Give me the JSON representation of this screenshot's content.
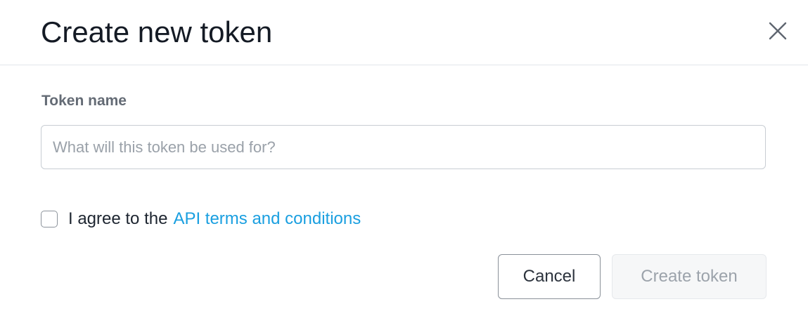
{
  "dialog": {
    "title": "Create new token",
    "close_icon": "close-icon"
  },
  "form": {
    "token_name_label": "Token name",
    "token_name_value": "",
    "token_name_placeholder": "What will this token be used for?",
    "agree_checked": false,
    "agree_text": "I agree to the",
    "terms_link_text": "API terms and conditions"
  },
  "actions": {
    "cancel_label": "Cancel",
    "create_label": "Create token",
    "create_disabled": true
  },
  "colors": {
    "link": "#1a9fe0",
    "title_text": "#141a24",
    "disabled_text": "#9ca3ab"
  }
}
